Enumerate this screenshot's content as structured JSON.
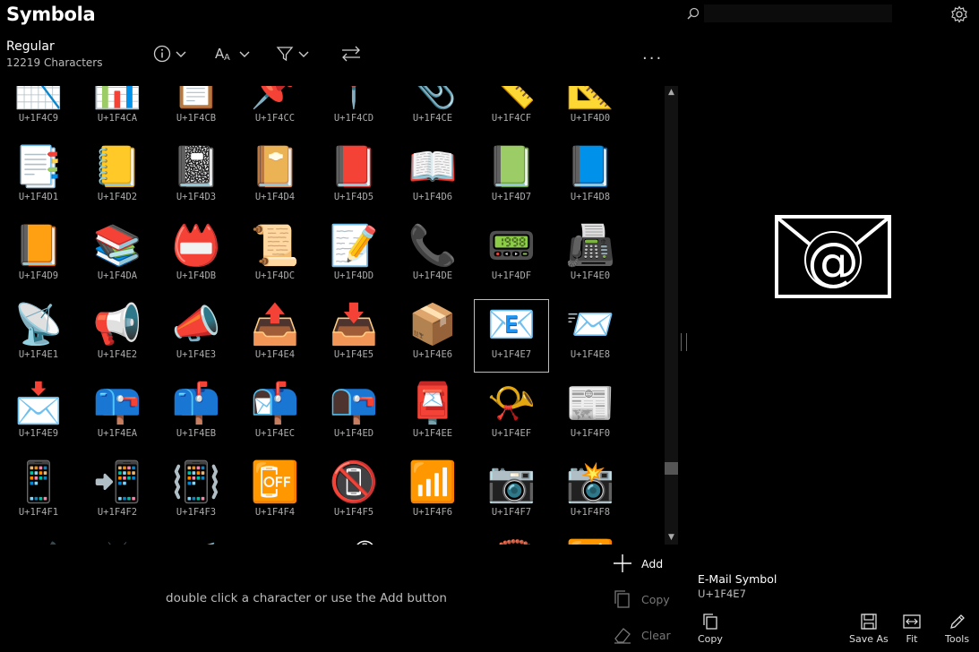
{
  "app": {
    "title": "Symbola",
    "weight": "Regular",
    "count": "12219 Characters"
  },
  "toolbar": {
    "more_label": "..."
  },
  "grid": {
    "rows": [
      {
        "glyphs": [
          "📉",
          "📊",
          "📋",
          "📌",
          "📍",
          "📎",
          "📏",
          "📐"
        ],
        "codes": [
          "U+1F4C9",
          "U+1F4CA",
          "U+1F4CB",
          "U+1F4CC",
          "U+1F4CD",
          "U+1F4CE",
          "U+1F4CF",
          "U+1F4D0"
        ]
      },
      {
        "glyphs": [
          "📑",
          "📒",
          "📓",
          "📔",
          "📕",
          "📖",
          "📗",
          "📘"
        ],
        "codes": [
          "U+1F4D1",
          "U+1F4D2",
          "U+1F4D3",
          "U+1F4D4",
          "U+1F4D5",
          "U+1F4D6",
          "U+1F4D7",
          "U+1F4D8"
        ]
      },
      {
        "glyphs": [
          "📙",
          "📚",
          "📛",
          "📜",
          "📝",
          "📞",
          "📟",
          "📠"
        ],
        "codes": [
          "U+1F4D9",
          "U+1F4DA",
          "U+1F4DB",
          "U+1F4DC",
          "U+1F4DD",
          "U+1F4DE",
          "U+1F4DF",
          "U+1F4E0"
        ]
      },
      {
        "glyphs": [
          "📡",
          "📢",
          "📣",
          "📤",
          "📥",
          "📦",
          "📧",
          "📨"
        ],
        "codes": [
          "U+1F4E1",
          "U+1F4E2",
          "U+1F4E3",
          "U+1F4E4",
          "U+1F4E5",
          "U+1F4E6",
          "U+1F4E7",
          "U+1F4E8"
        ]
      },
      {
        "glyphs": [
          "📩",
          "📪",
          "📫",
          "📬",
          "📭",
          "📮",
          "📯",
          "📰"
        ],
        "codes": [
          "U+1F4E9",
          "U+1F4EA",
          "U+1F4EB",
          "U+1F4EC",
          "U+1F4ED",
          "U+1F4EE",
          "U+1F4EF",
          "U+1F4F0"
        ]
      },
      {
        "glyphs": [
          "📱",
          "📲",
          "📳",
          "📴",
          "📵",
          "📶",
          "📷",
          "📸"
        ],
        "codes": [
          "U+1F4F1",
          "U+1F4F2",
          "U+1F4F3",
          "U+1F4F4",
          "U+1F4F5",
          "U+1F4F6",
          "U+1F4F7",
          "U+1F4F8"
        ]
      },
      {
        "glyphs": [
          "📹",
          "📺",
          "📻",
          "📼",
          "📽",
          "📾",
          "📿",
          "🔀"
        ],
        "codes": [
          "",
          "",
          "",
          "",
          "",
          "",
          "",
          ""
        ]
      }
    ],
    "selected": "U+1F4E7"
  },
  "bottom": {
    "hint": "double click a character or use the Add button",
    "add_label": "Add",
    "copy_label": "Copy",
    "clear_label": "Clear"
  },
  "right": {
    "search_placeholder": "",
    "preview_glyph": "📧",
    "char_name": "E-Mail Symbol",
    "char_code": "U+1F4E7",
    "copy_label": "Copy",
    "save_as_label": "Save As",
    "fit_label": "Fit",
    "tools_label": "Tools"
  }
}
